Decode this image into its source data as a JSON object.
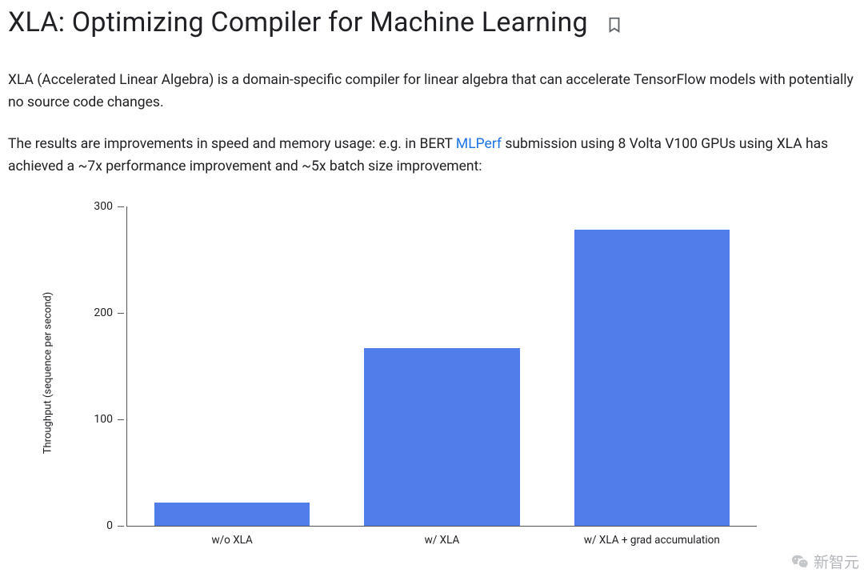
{
  "page": {
    "title": "XLA: Optimizing Compiler for Machine Learning",
    "para1": "XLA (Accelerated Linear Algebra) is a domain-specific compiler for linear algebra that can accelerate TensorFlow models with potentially no source code changes.",
    "para2_a": "The results are improvements in speed and memory usage: e.g. in BERT ",
    "para2_link_text": "MLPerf",
    "para2_b": " submission using 8 Volta V100 GPUs using XLA has achieved a ~7x performance improvement and ~5x batch size improvement:"
  },
  "watermark": {
    "text": "新智元"
  },
  "chart_data": {
    "type": "bar",
    "categories": [
      "w/o XLA",
      "w/ XLA",
      "w/ XLA + grad accumulation"
    ],
    "values": [
      22,
      167,
      278
    ],
    "ylabel": "Throughput (sequence per second)",
    "xlabel": "",
    "title": "",
    "ylim": [
      0,
      300
    ],
    "yticks": [
      0,
      100,
      200,
      300
    ],
    "bar_color": "#4f7de9"
  }
}
